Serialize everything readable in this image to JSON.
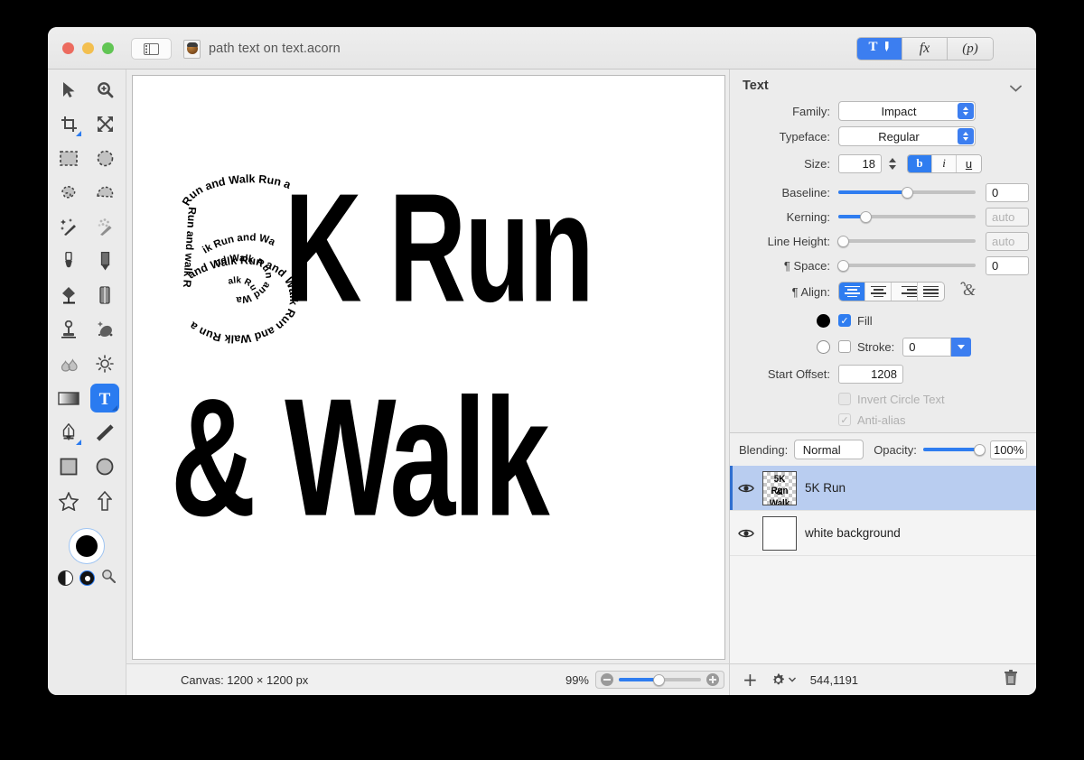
{
  "window": {
    "title": "path text on text.acorn",
    "traffic_lights": [
      "close",
      "minimize",
      "zoom"
    ],
    "sidebar_toggle": "sidebar-toggle",
    "mode_buttons": [
      {
        "id": "tool-inspector",
        "label": "T",
        "active": true
      },
      {
        "id": "filters",
        "label": "fx",
        "active": false
      },
      {
        "id": "palettes",
        "label": "(p)",
        "active": false
      }
    ]
  },
  "toolbar": {
    "tools": [
      {
        "name": "move-tool",
        "selected": false
      },
      {
        "name": "zoom-tool",
        "selected": false
      },
      {
        "name": "crop-tool",
        "selected": false
      },
      {
        "name": "transform-tool",
        "selected": false
      },
      {
        "name": "rectangular-marquee-tool",
        "selected": false
      },
      {
        "name": "elliptical-marquee-tool",
        "selected": false
      },
      {
        "name": "lasso-tool",
        "selected": false
      },
      {
        "name": "polygon-lasso-tool",
        "selected": false
      },
      {
        "name": "magic-wand-tool",
        "selected": false
      },
      {
        "name": "instant-alpha-tool",
        "selected": false
      },
      {
        "name": "brush-tool",
        "selected": false
      },
      {
        "name": "pencil-tool",
        "selected": false
      },
      {
        "name": "paint-bucket-tool",
        "selected": false
      },
      {
        "name": "eraser-tool",
        "selected": false
      },
      {
        "name": "clone-stamp-tool",
        "selected": false
      },
      {
        "name": "smudge-tool",
        "selected": false
      },
      {
        "name": "blur-tool",
        "selected": false
      },
      {
        "name": "dodge-tool",
        "selected": false
      },
      {
        "name": "gradient-tool",
        "selected": false
      },
      {
        "name": "text-tool",
        "selected": true
      },
      {
        "name": "bezier-pen-tool",
        "selected": false
      },
      {
        "name": "line-tool",
        "selected": false
      },
      {
        "name": "rectangle-tool",
        "selected": false
      },
      {
        "name": "ellipse-tool",
        "selected": false
      },
      {
        "name": "star-tool",
        "selected": false
      },
      {
        "name": "arrow-tool",
        "selected": false
      }
    ],
    "color_well": "#000000",
    "swatch_half": "half-tone-swatch",
    "swatch_ring": "ring-swatch",
    "magnifier": "magnifier-icon"
  },
  "canvas": {
    "artwork": {
      "line1": "K Run",
      "line2": "& Walk",
      "path_text": "Run and Walk Run and Walk Run and Walk Run and Walk Run and Walk Run and Walk Run and Walk Run and Walk Run and Walk Run and Walk Run and Walk Run and Walk"
    }
  },
  "inspector": {
    "title": "Text",
    "family": {
      "label": "Family:",
      "value": "Impact"
    },
    "typeface": {
      "label": "Typeface:",
      "value": "Regular"
    },
    "size": {
      "label": "Size:",
      "value": "18"
    },
    "style_buttons": [
      {
        "label": "b",
        "name": "bold-button",
        "active": true
      },
      {
        "label": "i",
        "name": "italic-button",
        "active": false
      },
      {
        "label": "u",
        "name": "underline-button",
        "active": false
      }
    ],
    "baseline": {
      "label": "Baseline:",
      "value": "0",
      "percent": 50
    },
    "kerning": {
      "label": "Kerning:",
      "value": "auto",
      "percent": 20
    },
    "line_height": {
      "label": "Line Height:",
      "value": "auto",
      "percent": 0
    },
    "space": {
      "label": "¶ Space:",
      "value": "0",
      "percent": 0
    },
    "align": {
      "label": "¶ Align:",
      "options": [
        "align-left",
        "align-center",
        "align-right",
        "align-justify"
      ],
      "selected": 0,
      "ligature_icon": "ampersand-ligature-icon"
    },
    "fill": {
      "label": "Fill",
      "checked": true,
      "color": "#000000"
    },
    "stroke": {
      "label": "Stroke:",
      "checked": false,
      "value": "0",
      "color": "#ffffff"
    },
    "start_offset": {
      "label": "Start Offset:",
      "value": "1208"
    },
    "invert_circle_text": {
      "label": "Invert Circle Text",
      "checked": false,
      "disabled": true
    },
    "anti_alias": {
      "label": "Anti-alias",
      "checked": true,
      "disabled": true
    }
  },
  "layers_panel": {
    "blending": {
      "label": "Blending:",
      "value": "Normal"
    },
    "opacity": {
      "label": "Opacity:",
      "value": "100%",
      "percent": 100
    },
    "layers": [
      {
        "name": "5K Run",
        "visible": true,
        "selected": true,
        "thumb_line1": "5K Run",
        "thumb_line2": "& Walk"
      },
      {
        "name": "white background",
        "visible": true,
        "selected": false
      }
    ]
  },
  "status": {
    "canvas_info": "Canvas: 1200 × 1200 px",
    "zoom_percent": "99%",
    "zoom_slider_percent": 49,
    "add_layer_icon": "plus-icon",
    "settings_icon": "gear-icon",
    "coordinates": "544,1191",
    "delete_icon": "trash-icon"
  },
  "colors": {
    "accent": "#2f7df0",
    "window_bg": "#ececec",
    "selected_layer": "#b9cdf0"
  }
}
